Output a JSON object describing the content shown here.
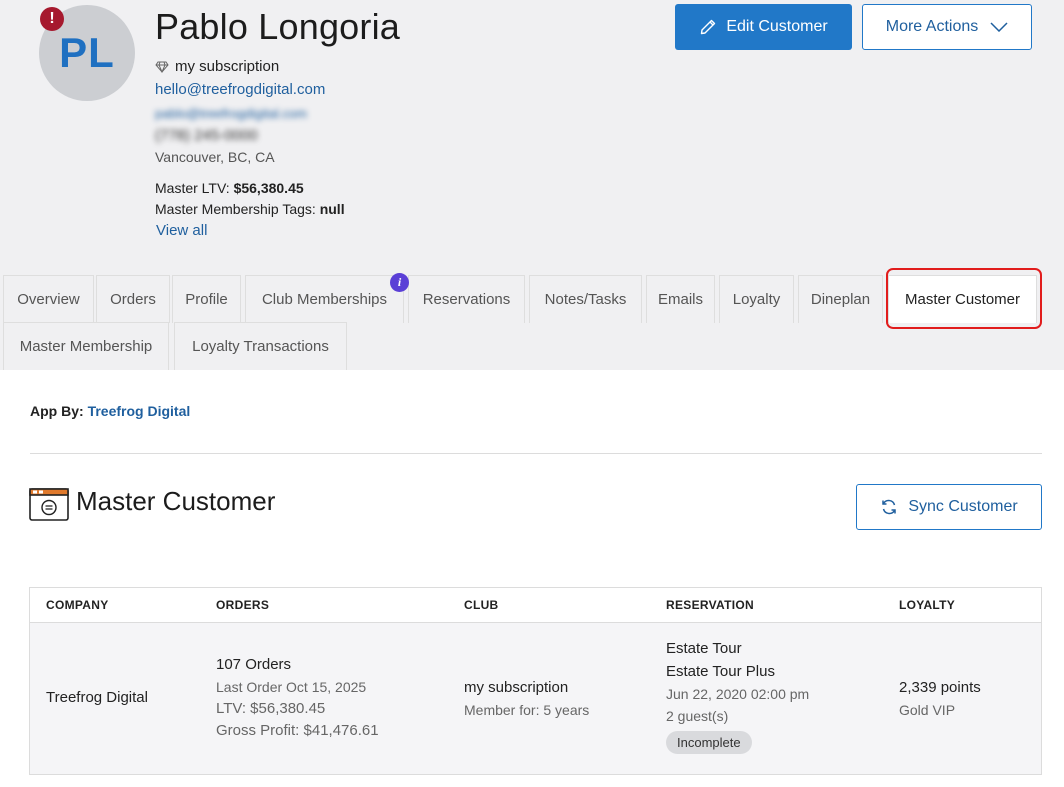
{
  "customer": {
    "initials": "PL",
    "alert_glyph": "!",
    "name": "Pablo Longoria",
    "subscription": "my subscription",
    "email": "hello@treefrogdigital.com",
    "email_secondary": "pablo@treefrogdigital.com",
    "phone": "(778) 245-0000",
    "location": "Vancouver, BC, CA",
    "master_ltv_label": "Master LTV:",
    "master_ltv_value": "$56,380.45",
    "membership_tags_label": "Master Membership Tags:",
    "membership_tags_value": "null",
    "view_all": "View all"
  },
  "actions": {
    "edit_label": "Edit Customer",
    "more_label": "More Actions"
  },
  "tabs": [
    {
      "label": "Overview"
    },
    {
      "label": "Orders"
    },
    {
      "label": "Profile"
    },
    {
      "label": "Club Memberships",
      "badge": "i"
    },
    {
      "label": "Reservations"
    },
    {
      "label": "Notes/Tasks"
    },
    {
      "label": "Emails"
    },
    {
      "label": "Loyalty"
    },
    {
      "label": "Dineplan"
    },
    {
      "label": "Master Customer",
      "active": true
    },
    {
      "label": "Master Membership"
    },
    {
      "label": "Loyalty Transactions"
    }
  ],
  "content": {
    "app_by_label": "App By:",
    "app_by_link": "Treefrog Digital",
    "section_title": "Master Customer",
    "sync_label": "Sync Customer"
  },
  "table": {
    "headers": [
      "COMPANY",
      "ORDERS",
      "CLUB",
      "RESERVATION",
      "LOYALTY"
    ],
    "row": {
      "company": "Treefrog Digital",
      "orders_count": "107 Orders",
      "last_order": "Last Order Oct 15, 2025",
      "ltv": "LTV: $56,380.45",
      "gross_profit": "Gross Profit: $41,476.61",
      "club_name": "my subscription",
      "club_member_for": "Member for: 5 years",
      "reservation_1": "Estate Tour",
      "reservation_2": "Estate Tour Plus",
      "reservation_date": "Jun 22, 2020 02:00 pm",
      "reservation_guests": "2 guest(s)",
      "reservation_status": "Incomplete",
      "loyalty_points": "2,339 points",
      "loyalty_tier": "Gold VIP"
    }
  },
  "colors": {
    "accent": "#2178c8",
    "link": "#1f5f9e",
    "alert": "#a6192e",
    "info_badge": "#5a3fd6",
    "active_tab_highlight": "#e11c1c"
  }
}
